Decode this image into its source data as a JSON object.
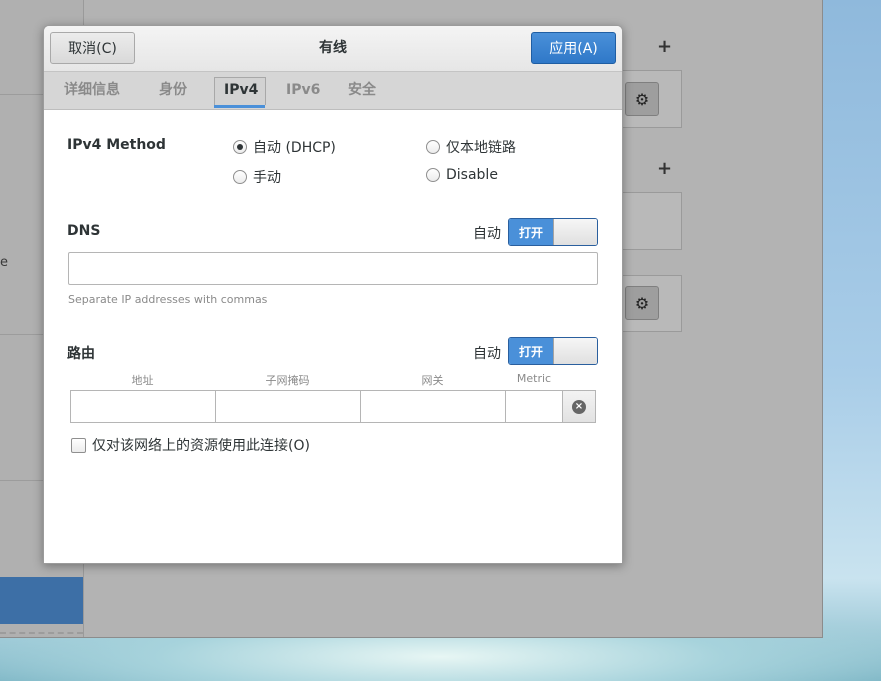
{
  "background": {
    "sidebar_text": "e",
    "plus_icon": "+",
    "gear_icon": "⚙"
  },
  "dialog": {
    "title": "有线",
    "cancel_label": "取消(C)",
    "apply_label": "应用(A)",
    "tabs": [
      {
        "label": "详细信息",
        "active": false
      },
      {
        "label": "身份",
        "active": false
      },
      {
        "label": "IPv4",
        "active": true
      },
      {
        "label": "IPv6",
        "active": false
      },
      {
        "label": "安全",
        "active": false
      }
    ]
  },
  "ipv4": {
    "method_label": "IPv4 Method",
    "methods": [
      {
        "label": "自动 (DHCP)",
        "selected": true
      },
      {
        "label": "仅本地链路",
        "selected": false
      },
      {
        "label": "手动",
        "selected": false
      },
      {
        "label": "Disable",
        "selected": false
      }
    ],
    "dns": {
      "label": "DNS",
      "auto_label": "自动",
      "switch_label": "打开",
      "value": "",
      "hint": "Separate IP addresses with commas"
    },
    "routes": {
      "label": "路由",
      "auto_label": "自动",
      "switch_label": "打开",
      "columns": [
        "地址",
        "子网掩码",
        "网关",
        "Metric"
      ],
      "row": [
        "",
        "",
        "",
        ""
      ]
    },
    "only_local_label": "仅对该网络上的资源使用此连接(O)"
  },
  "colors": {
    "accent": "#4a90d9",
    "apply_button": "#2f78c8",
    "sidebar_selected": "#3d6fa6"
  }
}
